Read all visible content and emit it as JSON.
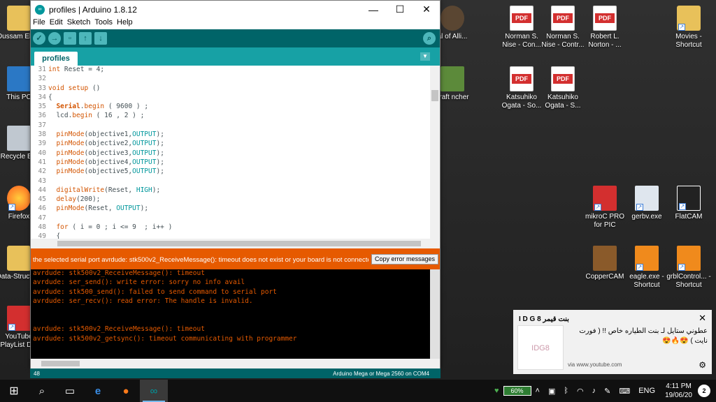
{
  "desktop": {
    "icons_left": [
      {
        "label": "Oussam Elfert"
      },
      {
        "label": "This PC"
      },
      {
        "label": "Recycle Bin"
      },
      {
        "label": "Firefox"
      },
      {
        "label": "Data-Structure"
      },
      {
        "label": "YouTube PlayList D..."
      }
    ],
    "icons_partial": [
      {
        "label": "al of Alli..."
      },
      {
        "label": "craft ncher"
      }
    ],
    "icons_right": [
      {
        "label": "Norman S. Nise - Con..."
      },
      {
        "label": "Norman S. Nise - Contr..."
      },
      {
        "label": "Robert L. Norton - ..."
      },
      {
        "label": "Movies - Shortcut"
      },
      {
        "label": "Katsuhiko Ogata - So..."
      },
      {
        "label": "Katsuhiko Ogata - S..."
      },
      {
        "label": "mikroC PRO for PIC"
      },
      {
        "label": "gerbv.exe"
      },
      {
        "label": "FlatCAM"
      },
      {
        "label": "CopperCAM"
      },
      {
        "label": "eagle.exe - Shortcut"
      },
      {
        "label": "grblControl... - Shortcut"
      }
    ]
  },
  "window": {
    "title": "profiles | Arduino 1.8.12",
    "menu": [
      "File",
      "Edit",
      "Sketch",
      "Tools",
      "Help"
    ],
    "tab": "profiles",
    "code": [
      {
        "n": "31",
        "t": "int Reset = 4;"
      },
      {
        "n": "32",
        "t": ""
      },
      {
        "n": "33",
        "t": "void setup ()"
      },
      {
        "n": "34",
        "t": "{"
      },
      {
        "n": "35",
        "t": "  Serial.begin ( 9600 ) ;"
      },
      {
        "n": "36",
        "t": "  lcd.begin ( 16 , 2 ) ;"
      },
      {
        "n": "37",
        "t": ""
      },
      {
        "n": "38",
        "t": "  pinMode(objective1,OUTPUT);"
      },
      {
        "n": "39",
        "t": "  pinMode(objective2,OUTPUT);"
      },
      {
        "n": "40",
        "t": "  pinMode(objective3,OUTPUT);"
      },
      {
        "n": "41",
        "t": "  pinMode(objective4,OUTPUT);"
      },
      {
        "n": "42",
        "t": "  pinMode(objective5,OUTPUT);"
      },
      {
        "n": "43",
        "t": ""
      },
      {
        "n": "44",
        "t": "  digitalWrite(Reset, HIGH);"
      },
      {
        "n": "45",
        "t": "  delay(200);"
      },
      {
        "n": "46",
        "t": "  pinMode(Reset, OUTPUT);"
      },
      {
        "n": "47",
        "t": ""
      },
      {
        "n": "48",
        "t": "  for ( i = 0 ; i <= 9  ; i++ )"
      },
      {
        "n": "49",
        "t": "  {"
      }
    ],
    "error_bar": "the selected serial port avrdude: stk500v2_ReceiveMessage(): timeout does not exist or your board is not connected",
    "copy_button": "Copy error messages",
    "console": [
      "avrdude: stk500v2_ReceiveMessage(): timeout",
      "avrdude: ser_send(): write error: sorry no info avail",
      "avrdude: stk500_send(): failed to send command to serial port",
      "avrdude: ser_recv(): read error: The handle is invalid.",
      "",
      "",
      "avrdude: stk500v2_ReceiveMessage(): timeout",
      "avrdude: stk500v2_getsync(): timeout communicating with programmer"
    ],
    "status_line": "48",
    "status_board": "Arduino Mega or Mega 2560 on COM4"
  },
  "notification": {
    "header": "بنت قيمر I D G 8",
    "message": "عطوني ستايل لـ بنت الطياره خاص !! ( فورت نايت ) 😍🔥😍",
    "source": "via www.youtube.com",
    "thumb_text": "IDG8"
  },
  "taskbar": {
    "battery": "60%",
    "lang": "ENG",
    "time": "4:11 PM",
    "date": "19/06/20",
    "notif_count": "2"
  }
}
